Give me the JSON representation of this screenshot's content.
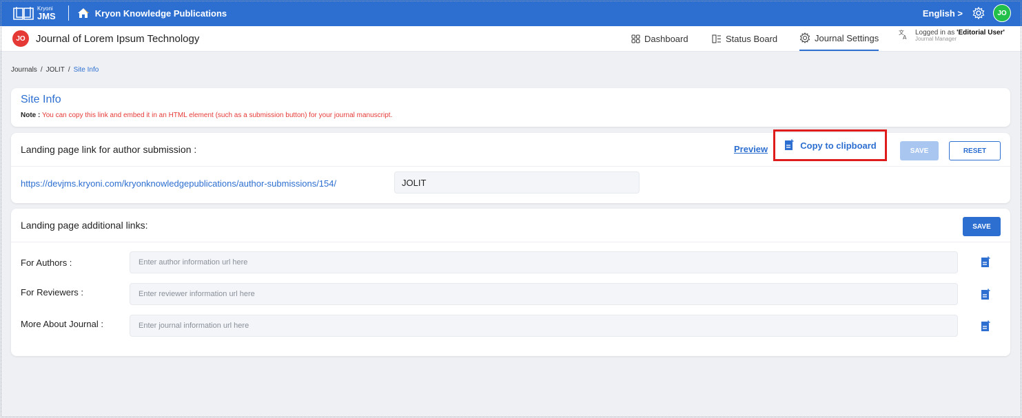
{
  "topbar": {
    "logo_small": "Kryoni",
    "logo_big": "JMS",
    "org_name": "Kryon Knowledge Publications",
    "language": "English >",
    "user_initials": "JO"
  },
  "subbar": {
    "journal_initials": "JO",
    "journal_title": "Journal of Lorem Ipsum Technology",
    "nav": {
      "dashboard": "Dashboard",
      "status_board": "Status Board",
      "journal_settings": "Journal Settings"
    },
    "logged_prefix": "Logged in as ",
    "logged_user": "'Editorial User'",
    "logged_role": "Journal Manager"
  },
  "breadcrumb": {
    "journals": "Journals",
    "journal": "JOLIT",
    "current": "Site Info",
    "separator": "/"
  },
  "site_info": {
    "title": "Site Info",
    "note_label": "Note :",
    "note_text": " You can copy this link and embed it in an HTML element (such as a submission button) for your journal manuscript."
  },
  "landing_link": {
    "title": "Landing page link for author submission :",
    "preview": "Preview",
    "copy": "Copy to clipboard",
    "save": "SAVE",
    "reset": "RESET",
    "url_prefix": "https://devjms.kryoni.com/kryonknowledgepublications/author-submissions/154/",
    "url_value": "JOLIT"
  },
  "additional_links": {
    "title": "Landing page additional links:",
    "save": "SAVE",
    "fields": [
      {
        "label": "For Authors :",
        "placeholder": "Enter author information url here"
      },
      {
        "label": "For Reviewers :",
        "placeholder": "Enter reviewer information url here"
      },
      {
        "label": "More About Journal :",
        "placeholder": "Enter journal information url here"
      }
    ]
  },
  "colors": {
    "primary": "#2d6fd1",
    "highlight": "#e01b1b",
    "note": "#e53935",
    "avatar_green": "#22c04a"
  },
  "icons": [
    "book-logo-icon",
    "home-icon",
    "gear-icon",
    "dashboard-grid-icon",
    "status-board-icon",
    "journal-settings-icon",
    "translate-icon",
    "copy-document-icon"
  ]
}
